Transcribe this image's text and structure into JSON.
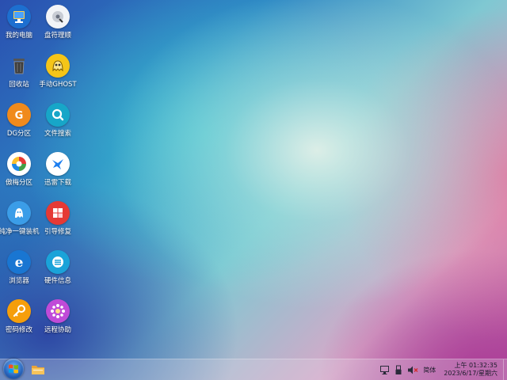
{
  "desktop": {
    "icons": [
      {
        "label": "我的电脑",
        "icon": "computer-icon"
      },
      {
        "label": "盘符理顺",
        "icon": "disk-order-icon"
      },
      {
        "label": "回收站",
        "icon": "recycle-bin-icon"
      },
      {
        "label": "手动GHOST",
        "icon": "ghost-icon"
      },
      {
        "label": "DG分区",
        "icon": "diskgenius-icon"
      },
      {
        "label": "文件搜索",
        "icon": "file-search-icon"
      },
      {
        "label": "傲梅分区",
        "icon": "aomei-partition-icon"
      },
      {
        "label": "迅雷下载",
        "icon": "thunder-download-icon"
      },
      {
        "label": "纯净一键装机",
        "icon": "one-key-install-icon"
      },
      {
        "label": "引导修复",
        "icon": "boot-repair-icon"
      },
      {
        "label": "浏览器",
        "icon": "browser-icon"
      },
      {
        "label": "硬件信息",
        "icon": "hardware-info-icon"
      },
      {
        "label": "密码修改",
        "icon": "password-key-icon"
      },
      {
        "label": "远程协助",
        "icon": "remote-assist-icon"
      }
    ]
  },
  "taskbar": {
    "start": "start-orb-icon",
    "pinned": [
      "file-explorer-icon"
    ],
    "tray": {
      "icons": [
        "network-icon",
        "usb-icon",
        "volume-muted-icon"
      ],
      "ime": "简体"
    },
    "clock": {
      "time": "上午 01:32:35",
      "date": "2023/6/17/星期六"
    }
  },
  "colors": {
    "taskbar": "#e1dceb",
    "icon_label": "#ffffff"
  }
}
